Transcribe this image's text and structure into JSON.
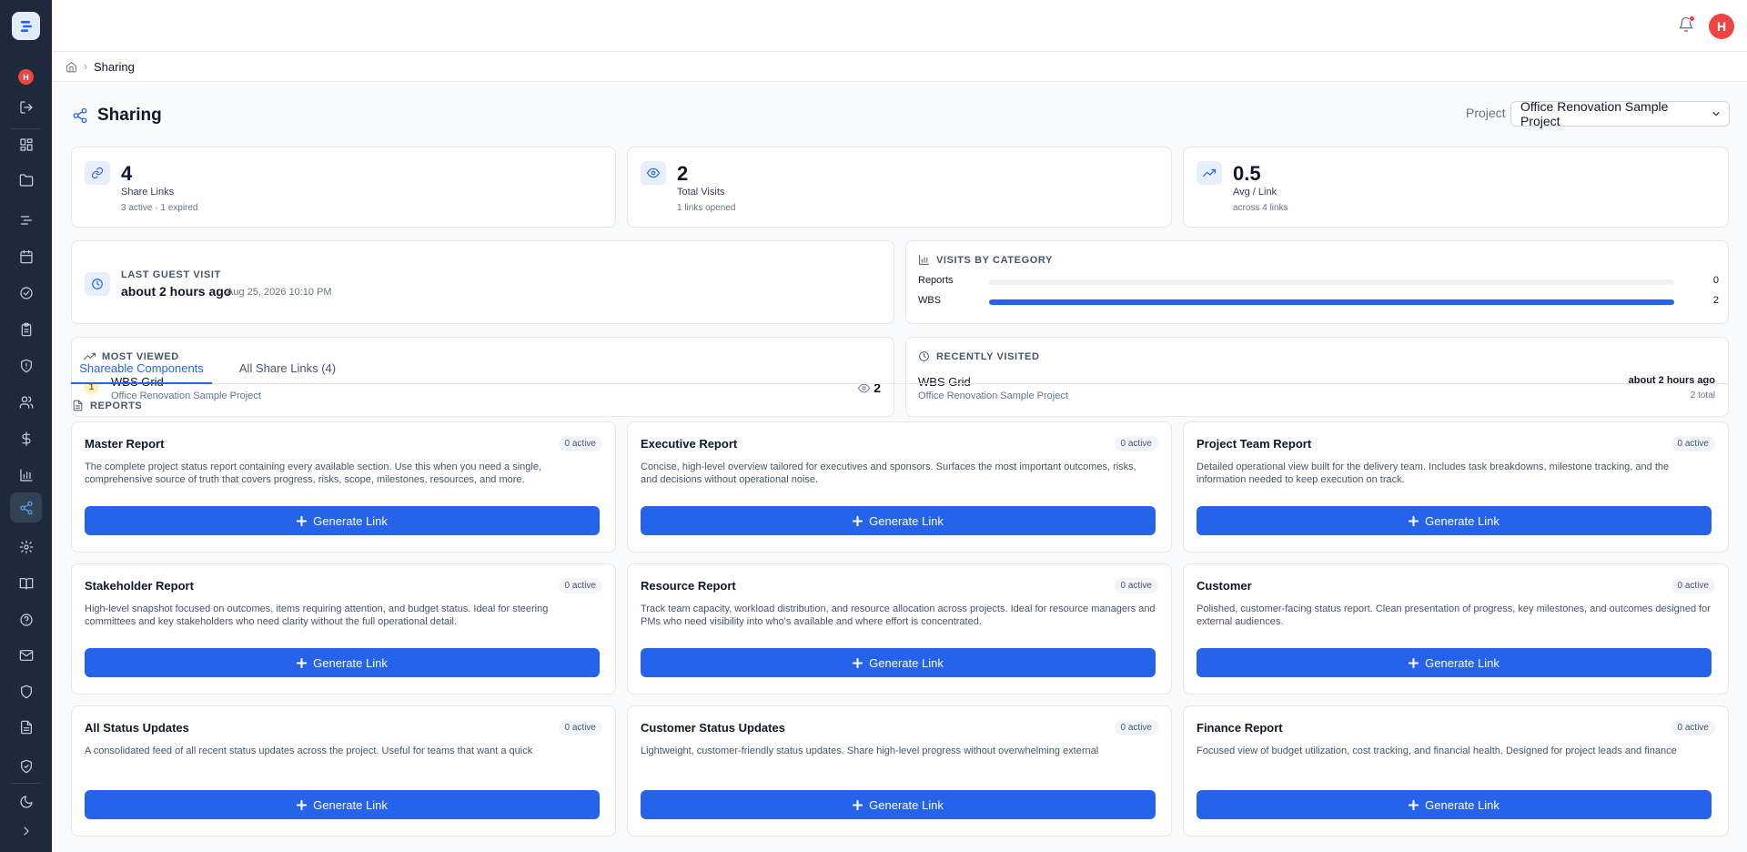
{
  "app": {
    "logo_icon": "gantt-logo-icon",
    "user_initial": "H",
    "accent": "#2563eb",
    "sidebar_bg": "#1e293b"
  },
  "header": {
    "user_initial": "H",
    "notification_icon": "bell-icon"
  },
  "breadcrumb": {
    "current": "Sharing"
  },
  "page": {
    "title": "Sharing",
    "project_label": "Project",
    "project_value": "Office Renovation Sample Project"
  },
  "stats": [
    {
      "value": "4",
      "label": "Share Links",
      "sub": "3 active · 1 expired",
      "icon": "link-icon"
    },
    {
      "value": "2",
      "label": "Total Visits",
      "sub": "1 links opened",
      "icon": "eye-icon"
    },
    {
      "value": "0.5",
      "label": "Avg / Link",
      "sub": "across 4 links",
      "icon": "trending-up-icon"
    }
  ],
  "last_guest_visit": {
    "title": "LAST GUEST VISIT",
    "relative": "about 2 hours ago",
    "absolute": "Aug 25, 2026 10:10 PM"
  },
  "visits_by_category": {
    "title": "VISITS BY CATEGORY",
    "rows": [
      {
        "label": "Reports",
        "count": "0",
        "fraction": 0
      },
      {
        "label": "WBS",
        "count": "2",
        "fraction": 1
      }
    ]
  },
  "most_viewed": {
    "title": "MOST VIEWED",
    "rank": "1",
    "name": "WBS Grid",
    "project": "Office Renovation Sample Project",
    "views": "2"
  },
  "recently_visited": {
    "title": "RECENTLY VISITED",
    "name": "WBS Grid",
    "project": "Office Renovation Sample Project",
    "time": "about 2 hours ago",
    "total": "2 total"
  },
  "tabs": [
    {
      "label": "Shareable Components"
    },
    {
      "label": "All Share Links (4)"
    }
  ],
  "reports_section": {
    "title": "REPORTS"
  },
  "generate_label": "Generate Link",
  "reports": [
    {
      "title": "Master Report",
      "badge": "0 active",
      "desc": "The complete project status report containing every available section. Use this when you need a single, comprehensive source of truth that covers progress, risks, scope, milestones, resources, and more."
    },
    {
      "title": "Executive Report",
      "badge": "0 active",
      "desc": "Concise, high-level overview tailored for executives and sponsors. Surfaces the most important outcomes, risks, and decisions without operational noise."
    },
    {
      "title": "Project Team Report",
      "badge": "0 active",
      "desc": "Detailed operational view built for the delivery team. Includes task breakdowns, milestone tracking, and the information needed to keep execution on track."
    },
    {
      "title": "Stakeholder Report",
      "badge": "0 active",
      "desc": "High-level snapshot focused on outcomes, items requiring attention, and budget status. Ideal for steering committees and key stakeholders who need clarity without the full operational detail."
    },
    {
      "title": "Resource Report",
      "badge": "0 active",
      "desc": "Track team capacity, workload distribution, and resource allocation across projects. Ideal for resource managers and PMs who need visibility into who's available and where effort is concentrated."
    },
    {
      "title": "Customer",
      "badge": "0 active",
      "desc": "Polished, customer-facing status report. Clean presentation of progress, key milestones, and outcomes designed for external audiences."
    },
    {
      "title": "All Status Updates",
      "badge": "0 active",
      "desc": "A consolidated feed of all recent status updates across the project. Useful for teams that want a quick"
    },
    {
      "title": "Customer Status Updates",
      "badge": "0 active",
      "desc": "Lightweight, customer-friendly status updates. Share high-level progress without overwhelming external"
    },
    {
      "title": "Finance Report",
      "badge": "0 active",
      "desc": "Focused view of budget utilization, cost tracking, and financial health. Designed for project leads and finance"
    }
  ]
}
